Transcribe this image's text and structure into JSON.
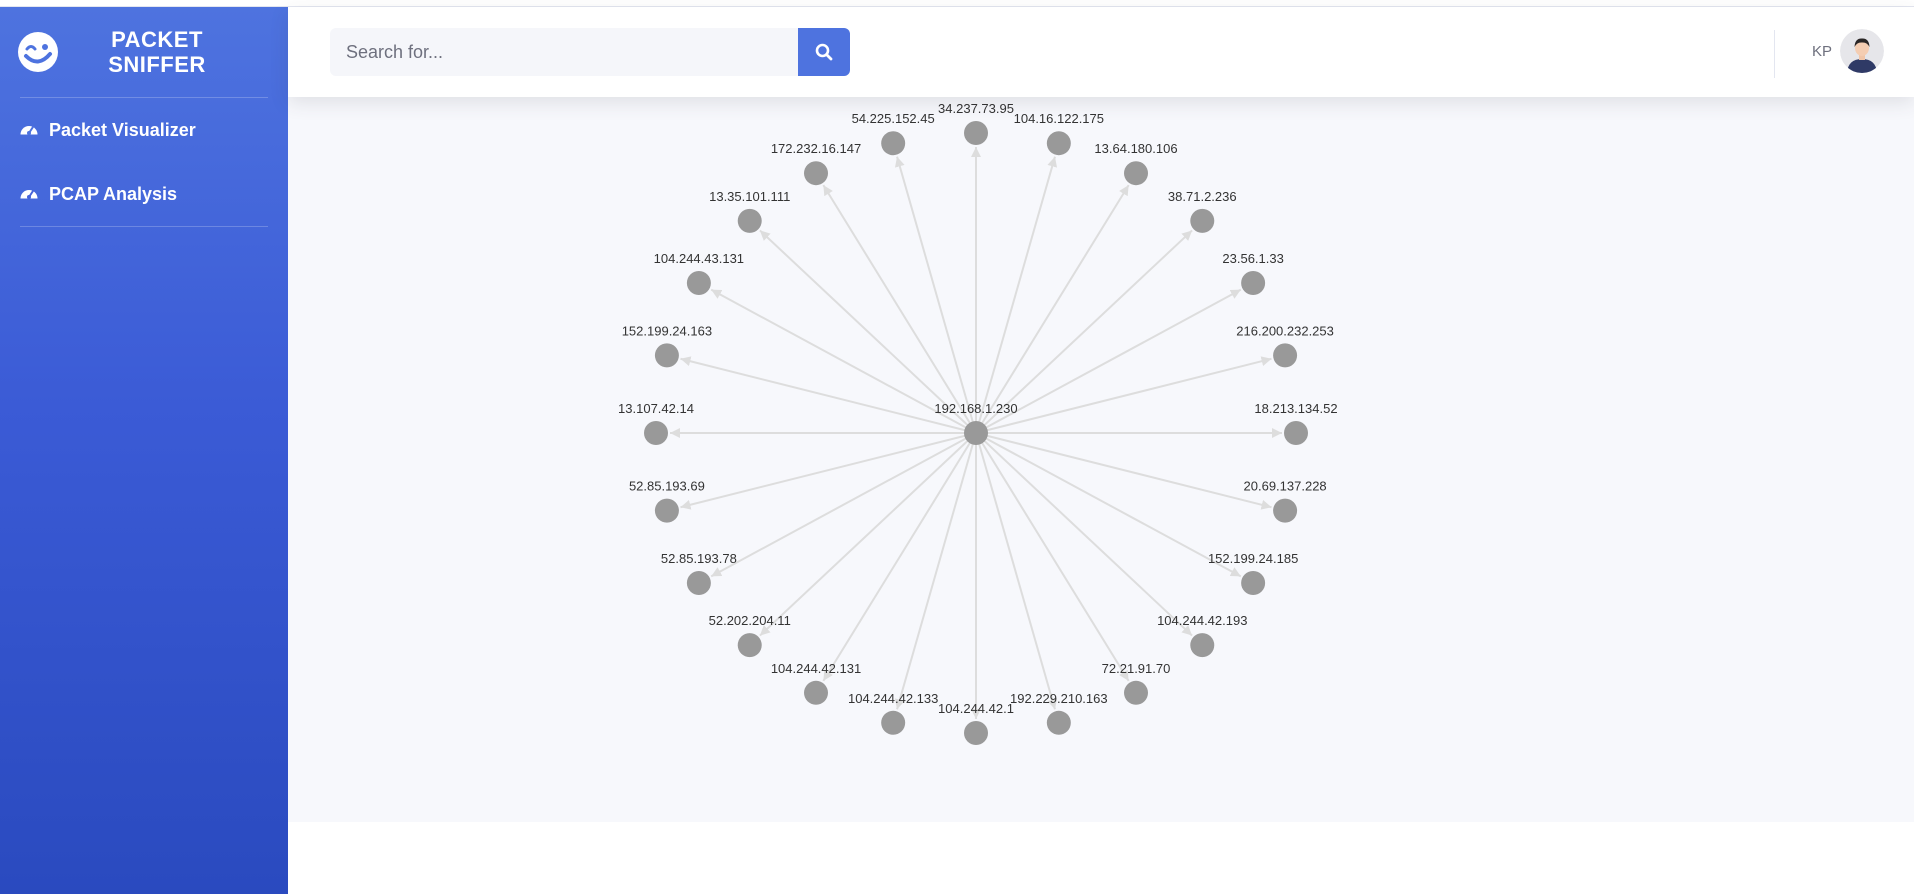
{
  "brand": {
    "name_line1": "PACKET",
    "name_line2": "SNIFFER",
    "logo_icon": "smiley-wink-icon"
  },
  "sidebar": {
    "items": [
      {
        "label": "Packet Visualizer",
        "icon": "tachometer-icon"
      },
      {
        "label": "PCAP Analysis",
        "icon": "tachometer-icon"
      }
    ]
  },
  "search": {
    "placeholder": "Search for...",
    "value": "",
    "button_icon": "search-icon"
  },
  "user": {
    "initials": "KP",
    "avatar_icon": "user-avatar"
  },
  "colors": {
    "sidebar_top": "#4e73df",
    "sidebar_bottom": "#2a4abf",
    "accent": "#4e73df",
    "node": "#999999",
    "edge": "#dddddd",
    "panel_bg": "#f7f8fc"
  },
  "graph": {
    "center": {
      "label": "192.168.1.230"
    },
    "nodes": [
      {
        "label": "34.237.73.95"
      },
      {
        "label": "104.16.122.175"
      },
      {
        "label": "13.64.180.106"
      },
      {
        "label": "38.71.2.236"
      },
      {
        "label": "23.56.1.33"
      },
      {
        "label": "216.200.232.253"
      },
      {
        "label": "18.213.134.52"
      },
      {
        "label": "20.69.137.228"
      },
      {
        "label": "152.199.24.185"
      },
      {
        "label": "104.244.42.193"
      },
      {
        "label": "72.21.91.70"
      },
      {
        "label": "192.229.210.163"
      },
      {
        "label": "104.244.42.1"
      },
      {
        "label": "104.244.42.133"
      },
      {
        "label": "104.244.42.131"
      },
      {
        "label": "52.202.204.11"
      },
      {
        "label": "52.85.193.78"
      },
      {
        "label": "52.85.193.69"
      },
      {
        "label": "13.107.42.14"
      },
      {
        "label": "152.199.24.163"
      },
      {
        "label": "104.244.43.131"
      },
      {
        "label": "13.35.101.111"
      },
      {
        "label": "172.232.16.147"
      },
      {
        "label": "54.225.152.45"
      }
    ]
  }
}
